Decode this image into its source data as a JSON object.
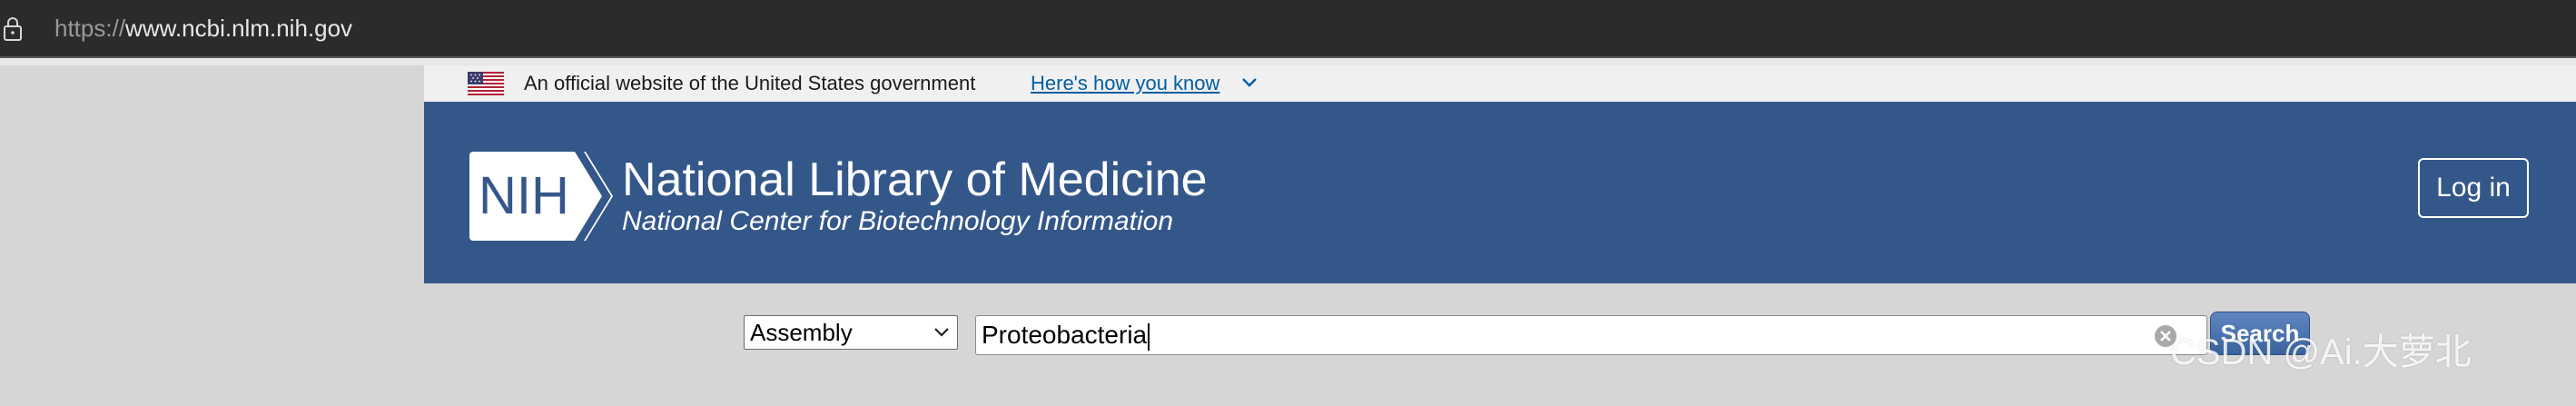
{
  "browser": {
    "url_scheme": "https://",
    "url_host": "www.ncbi.nlm.nih.gov",
    "lock_icon": "lock-icon"
  },
  "gov_banner": {
    "flag_icon": "us-flag-icon",
    "text": "An official website of the United States government",
    "link_text": "Here's how you know"
  },
  "header": {
    "logo_text": "NIH",
    "title": "National Library of Medicine",
    "subtitle": "National Center for Biotechnology Information",
    "login_label": "Log in",
    "background_color": "#34578a"
  },
  "search": {
    "database_selected": "Assembly",
    "query": "Proteobacteria",
    "button_label": "Search"
  },
  "watermark": "CSDN @Ai.大萝北"
}
